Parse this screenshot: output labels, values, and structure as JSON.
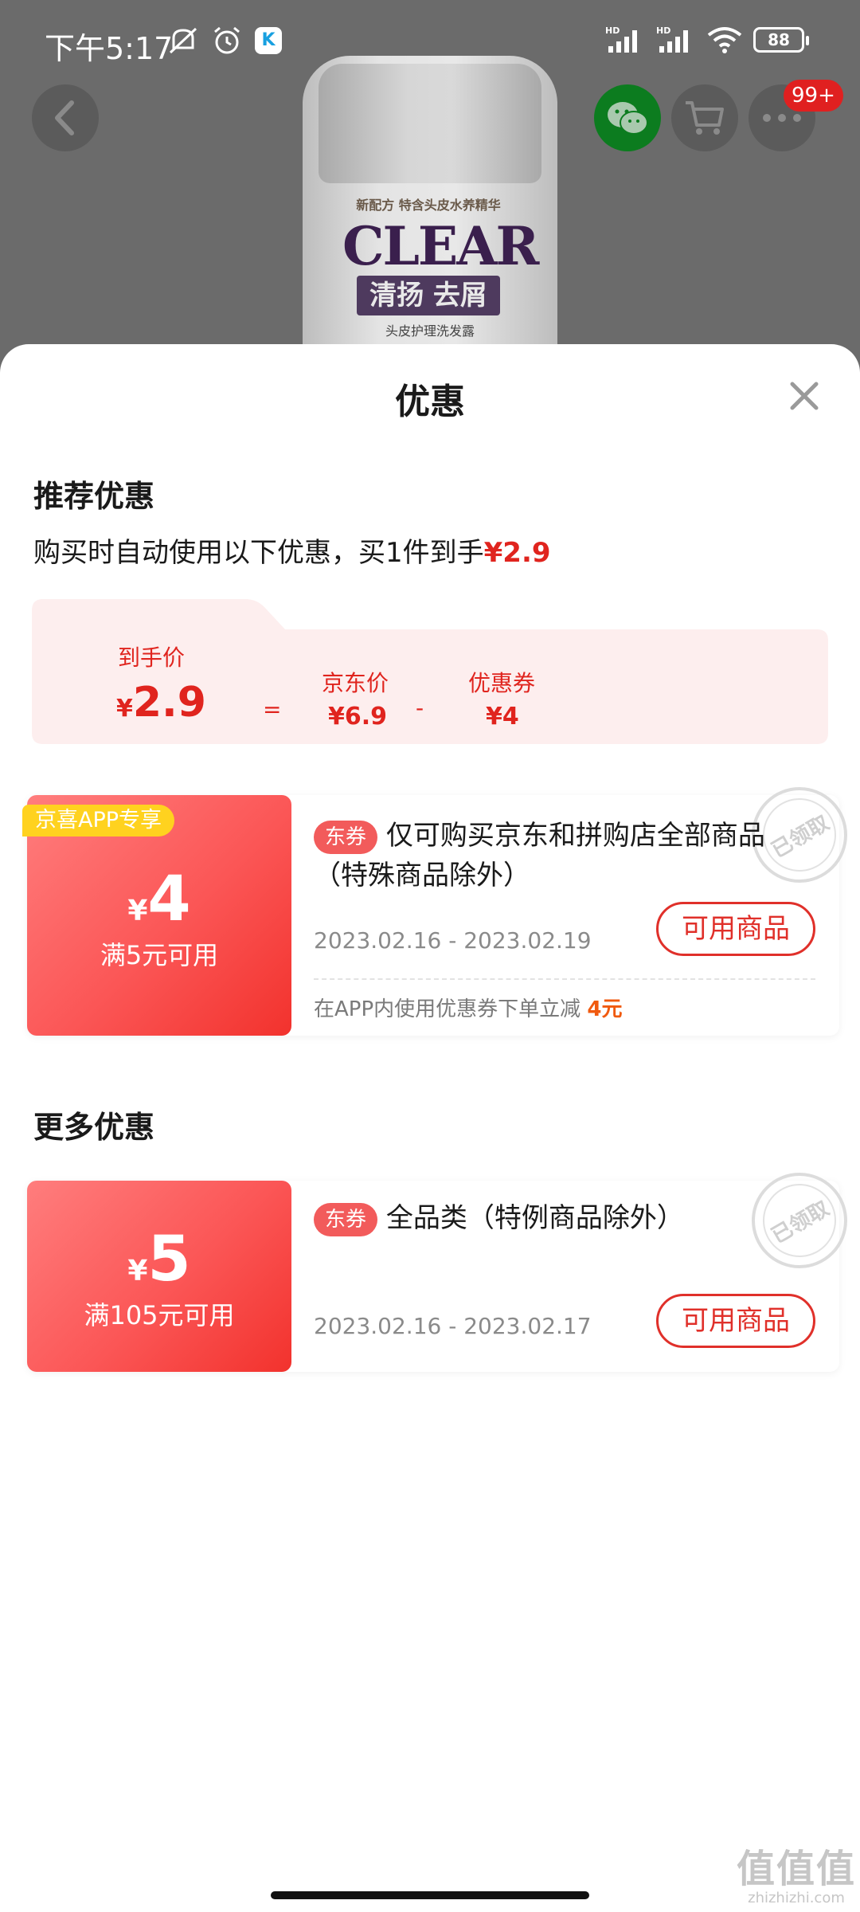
{
  "status_bar": {
    "time": "下午5:17",
    "app_badge": "K",
    "battery": "88",
    "signal_label_1": "HD",
    "signal_label_2": "HD"
  },
  "product": {
    "label_top": "新配方  特含头皮水养精华",
    "brand": "CLEAR",
    "sub_brand": "清扬 去屑",
    "desc": "头皮护理洗发露"
  },
  "header": {
    "cart_badge": "99+"
  },
  "sheet": {
    "title": "优惠",
    "recommended": {
      "title": "推荐优惠",
      "subtitle_prefix": "购买时自动使用以下优惠，买1件到手",
      "subtitle_price": "¥2.9"
    },
    "price_breakdown": {
      "final_label": "到手价",
      "final_yen": "¥",
      "final_value": "2.9",
      "eq": "=",
      "jd_label": "京东价",
      "jd_value": "¥6.9",
      "minus": "-",
      "coupon_label": "优惠券",
      "coupon_value": "¥4"
    },
    "coupons": [
      {
        "tag_top": "京喜APP专享",
        "yen": "¥",
        "amount": "4",
        "condition": "满5元可用",
        "type_tag": "东券",
        "desc": "仅可购买京东和拼购店全部商品（特殊商品除外）",
        "date": "2023.02.16 - 2023.02.19",
        "button": "可用商品",
        "stamp": "已领取",
        "note_prefix": "在APP内使用优惠券下单立减 ",
        "note_amount": "4元"
      }
    ],
    "more": {
      "title": "更多优惠",
      "coupons": [
        {
          "yen": "¥",
          "amount": "5",
          "condition": "满105元可用",
          "type_tag": "东券",
          "desc": "全品类（特例商品除外）",
          "date": "2023.02.16 - 2023.02.17",
          "button": "可用商品",
          "stamp": "已领取"
        }
      ]
    }
  },
  "watermark": {
    "big": "值值值",
    "small": "zhizhizhi.com"
  },
  "colors": {
    "accent_red": "#e0241e",
    "coupon_gradient_start": "#ff7d7d",
    "coupon_gradient_end": "#f2322d",
    "price_card_bg": "#fdeeee",
    "jx_tag": "#ffd21f",
    "note_orange": "#f05a0f"
  }
}
